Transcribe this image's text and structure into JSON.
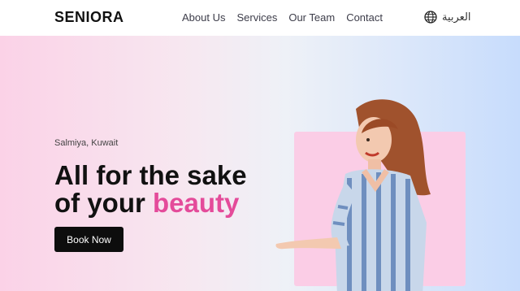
{
  "header": {
    "brand": "SENIORA",
    "nav": [
      "About Us",
      "Services",
      "Our Team",
      "Contact"
    ],
    "language": {
      "label": "العربية",
      "icon": "globe-icon"
    }
  },
  "hero": {
    "location": "Salmiya, Kuwait",
    "headline_line1": "All for the sake",
    "headline_line2_prefix": "of your ",
    "headline_accent": "beauty",
    "cta": "Book Now"
  },
  "colors": {
    "accent": "#e44b9a",
    "card": "#fbcde6",
    "button": "#0d0d0d"
  }
}
